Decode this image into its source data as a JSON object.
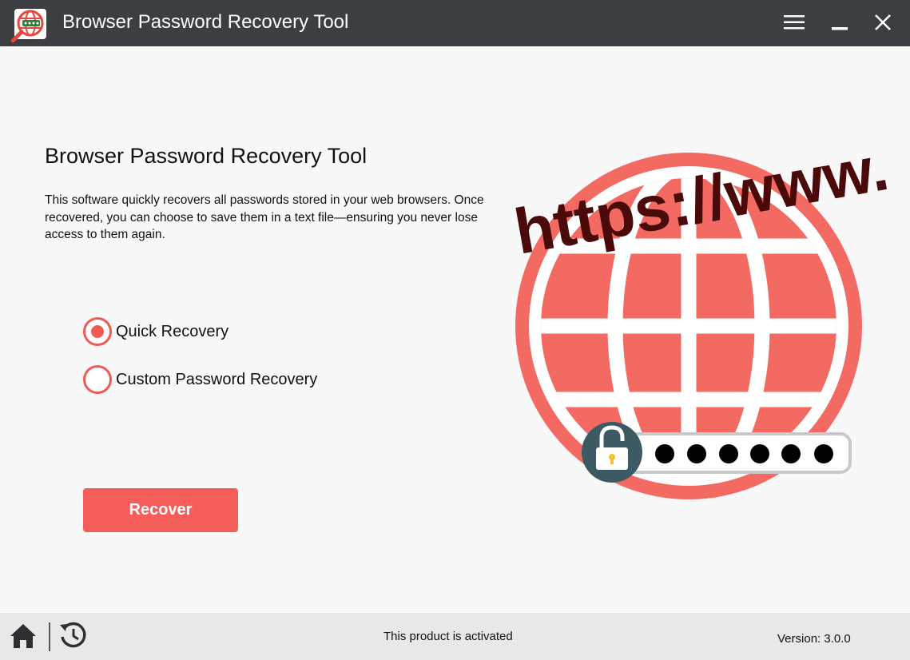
{
  "window": {
    "title": "Browser Password Recovery Tool",
    "icons": {
      "app": "globe-password-app-icon",
      "menu": "hamburger-menu-icon",
      "minimize": "minimize-icon",
      "close": "close-icon"
    }
  },
  "main": {
    "heading": "Browser Password Recovery Tool",
    "description": "This software quickly recovers all passwords stored in your web browsers. Once recovered, you can choose to save them in a text file—ensuring you never lose access to them again.",
    "options": [
      {
        "label": "Quick Recovery",
        "selected": true
      },
      {
        "label": "Custom Password Recovery",
        "selected": false
      }
    ],
    "recover_label": "Recover"
  },
  "illustration": {
    "url_text": "https://www.",
    "icons": [
      "globe-icon",
      "padlock-icon",
      "password-dots-icon"
    ]
  },
  "footer": {
    "status": "This product is activated",
    "version": "Version: 3.0.0",
    "icons": {
      "home": "home-icon",
      "history": "history-icon"
    }
  },
  "colors": {
    "accent": "#f45d59",
    "titlebar": "#3b3e43",
    "footer": "#e8e8e8",
    "globe": "#f26a62",
    "url_text": "#4a0a0a",
    "lock_badge": "#3d5a64"
  }
}
